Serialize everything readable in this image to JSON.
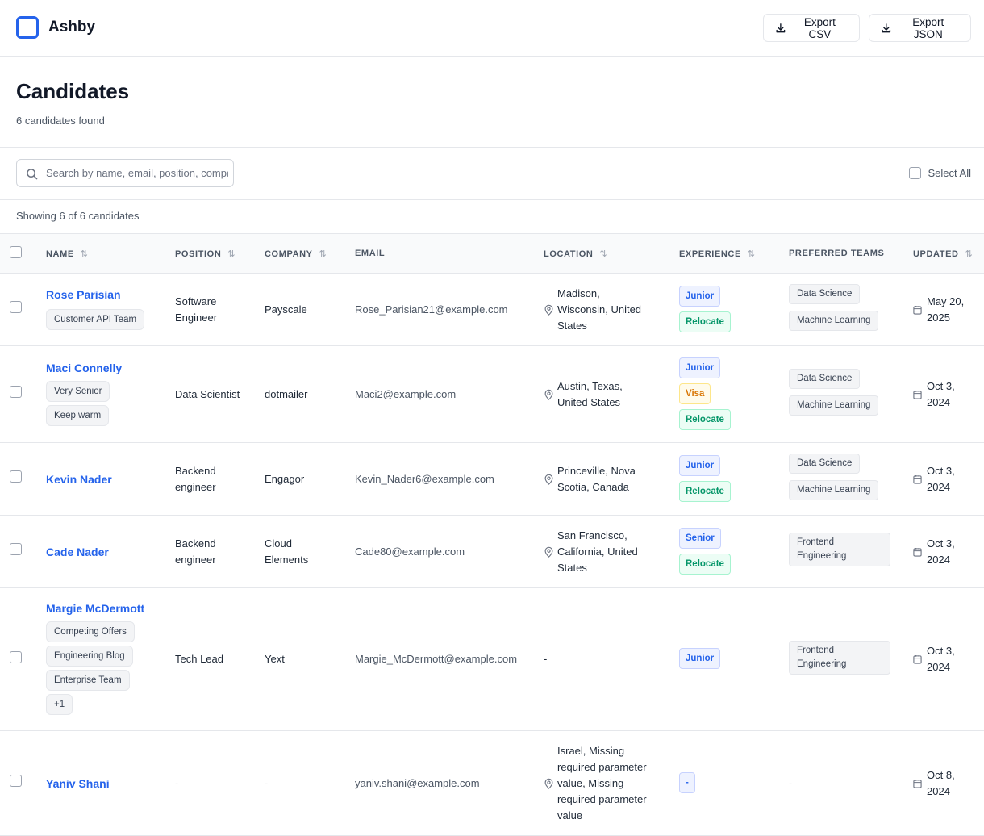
{
  "header": {
    "brand": "Ashby",
    "export_csv": "Export CSV",
    "export_json": "Export JSON"
  },
  "page": {
    "title": "Candidates",
    "subtitle": "6 candidates found"
  },
  "filters": {
    "search_placeholder": "Search by name, email, position, company...",
    "select_all": "Select All"
  },
  "showing": "Showing 6 of 6 candidates",
  "columns": {
    "name": "NAME",
    "position": "POSITION",
    "company": "COMPANY",
    "email": "EMAIL",
    "location": "LOCATION",
    "experience": "EXPERIENCE",
    "teams": "PREFERRED TEAMS",
    "updated": "UPDATED",
    "sort_glyph": "⇅"
  },
  "rows": [
    {
      "name": "Rose Parisian",
      "tags": [
        "Customer API Team"
      ],
      "position": [
        "Software",
        "Engineer"
      ],
      "company": [
        "Payscale"
      ],
      "email": "Rose_Parisian21@example.com",
      "location": [
        "Madison,",
        "Wisconsin, United",
        "States"
      ],
      "badges": [
        "Junior",
        "Relocate"
      ],
      "teams": [
        "Data Science",
        "Machine Learning"
      ],
      "updated": [
        "May 20,",
        "2025"
      ]
    },
    {
      "name": "Maci Connelly",
      "tags": [
        "Very Senior",
        "Keep warm"
      ],
      "position": [
        "Data Scientist"
      ],
      "company": [
        "dotmailer"
      ],
      "email": "Maci2@example.com",
      "location": [
        "Austin, Texas,",
        "United States"
      ],
      "badges": [
        "Junior",
        "Visa",
        "Relocate"
      ],
      "teams": [
        "Data Science",
        "Machine Learning"
      ],
      "updated": [
        "Oct 3,",
        "2024"
      ]
    },
    {
      "name": "Kevin Nader",
      "tags": [],
      "position": [
        "Backend",
        "engineer"
      ],
      "company": [
        "Engagor"
      ],
      "email": "Kevin_Nader6@example.com",
      "location": [
        "Princeville, Nova",
        "Scotia, Canada"
      ],
      "badges": [
        "Junior",
        "Relocate"
      ],
      "teams": [
        "Data Science",
        "Machine Learning"
      ],
      "updated": [
        "Oct 3,",
        "2024"
      ]
    },
    {
      "name": "Cade Nader",
      "tags": [],
      "position": [
        "Backend",
        "engineer"
      ],
      "company": [
        "Cloud",
        "Elements"
      ],
      "email": "Cade80@example.com",
      "location": [
        "San Francisco,",
        "California, United",
        "States"
      ],
      "badges": [
        "Senior",
        "Relocate"
      ],
      "teams": [
        "Frontend Engineering"
      ],
      "updated": [
        "Oct 3,",
        "2024"
      ]
    },
    {
      "name": "Margie McDermott",
      "tags": [
        "Competing Offers",
        "Engineering Blog",
        "Enterprise Team",
        "+1"
      ],
      "position": [
        "Tech Lead"
      ],
      "company": [
        "Yext"
      ],
      "email": "Margie_McDermott@example.com",
      "location_plain": "-",
      "badges": [
        "Junior"
      ],
      "teams": [
        "Frontend Engineering"
      ],
      "updated": [
        "Oct 3,",
        "2024"
      ]
    },
    {
      "name": "Yaniv Shani",
      "tags": [],
      "position_plain": "-",
      "company_plain": "-",
      "email": "yaniv.shani@example.com",
      "location": [
        "Israel, Missing",
        "required parameter",
        "value, Missing",
        "required parameter",
        "value"
      ],
      "badges": [
        "-"
      ],
      "teams_plain": "-",
      "updated": [
        "Oct 8,",
        "2024"
      ]
    }
  ]
}
